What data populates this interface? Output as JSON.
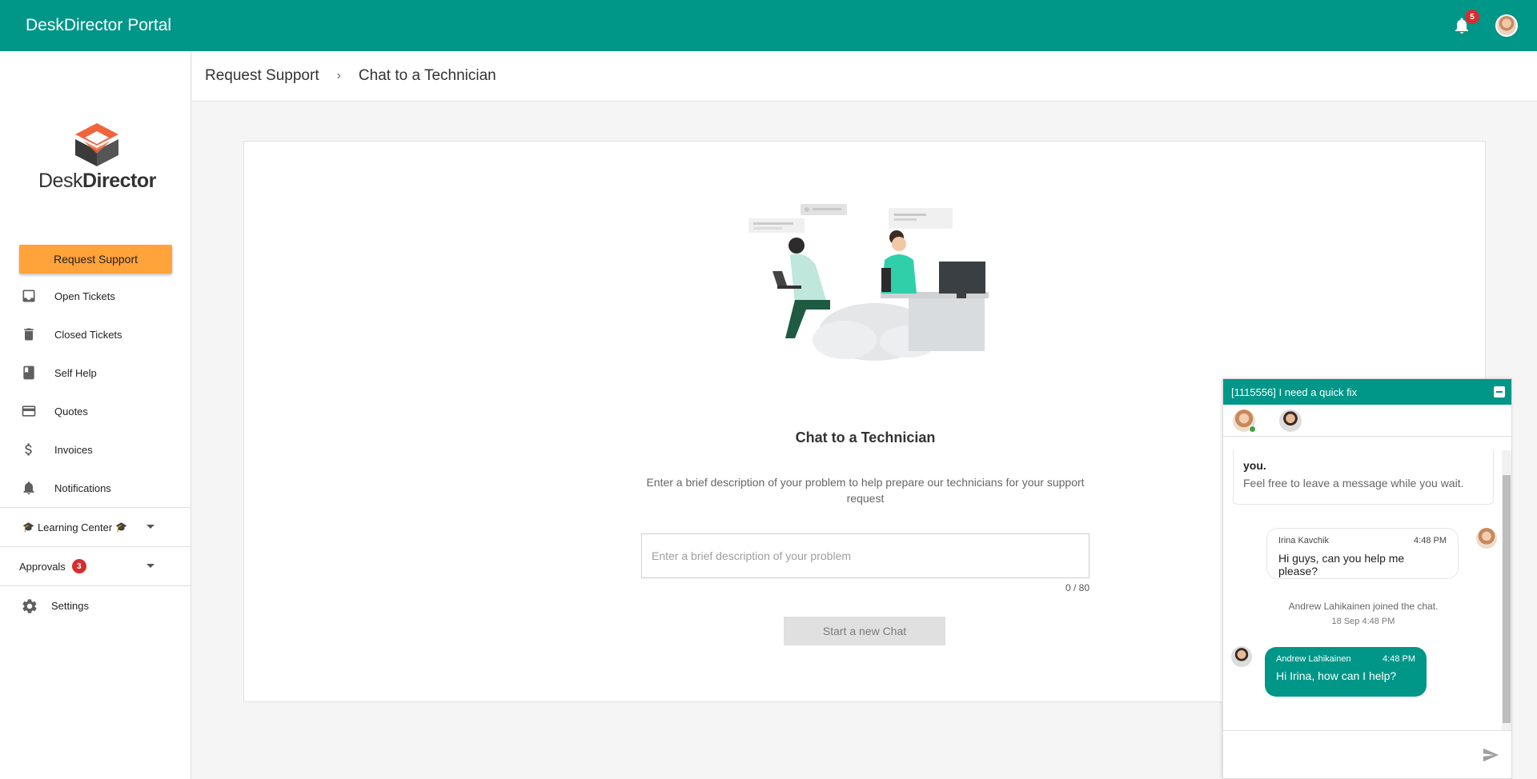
{
  "app": {
    "title": "DeskDirector Portal",
    "notification_count": "5",
    "accent_color": "#009688"
  },
  "logo": {
    "word_light": "Desk",
    "word_bold": "Director"
  },
  "sidebar": {
    "request_button": "Request Support",
    "items": [
      {
        "label": "Open Tickets",
        "icon": "inbox-icon"
      },
      {
        "label": "Closed Tickets",
        "icon": "trash-icon"
      },
      {
        "label": "Self Help",
        "icon": "book-icon"
      },
      {
        "label": "Quotes",
        "icon": "credit-card-icon"
      },
      {
        "label": "Invoices",
        "icon": "dollar-icon"
      },
      {
        "label": "Notifications",
        "icon": "bell-icon"
      }
    ],
    "learning_center": "Learning Center",
    "approvals": "Approvals",
    "approvals_count": "3",
    "settings": "Settings"
  },
  "breadcrumb": {
    "parent": "Request Support",
    "current": "Chat to a Technician"
  },
  "main": {
    "title": "Chat to a Technician",
    "description": "Enter a brief description of your problem to help prepare our technicians for your support request",
    "input_placeholder": "Enter a brief description of your problem",
    "input_value": "",
    "counter": "0 / 80",
    "start_button": "Start a new Chat"
  },
  "chat": {
    "title": "[1115556] I need a quick fix",
    "system_strong": "you.",
    "system_note": "Feel free to leave a message while you wait.",
    "messages": [
      {
        "author": "Irina Kavchik",
        "time": "4:48 PM",
        "text": "Hi guys, can you help me please?"
      },
      {
        "author": "Andrew Lahikainen",
        "time": "4:48 PM",
        "text": "Hi Irina, how can I help?"
      }
    ],
    "join_notice": "Andrew Lahikainen joined the chat.",
    "join_time": "18 Sep 4:48 PM",
    "composer_value": ""
  }
}
